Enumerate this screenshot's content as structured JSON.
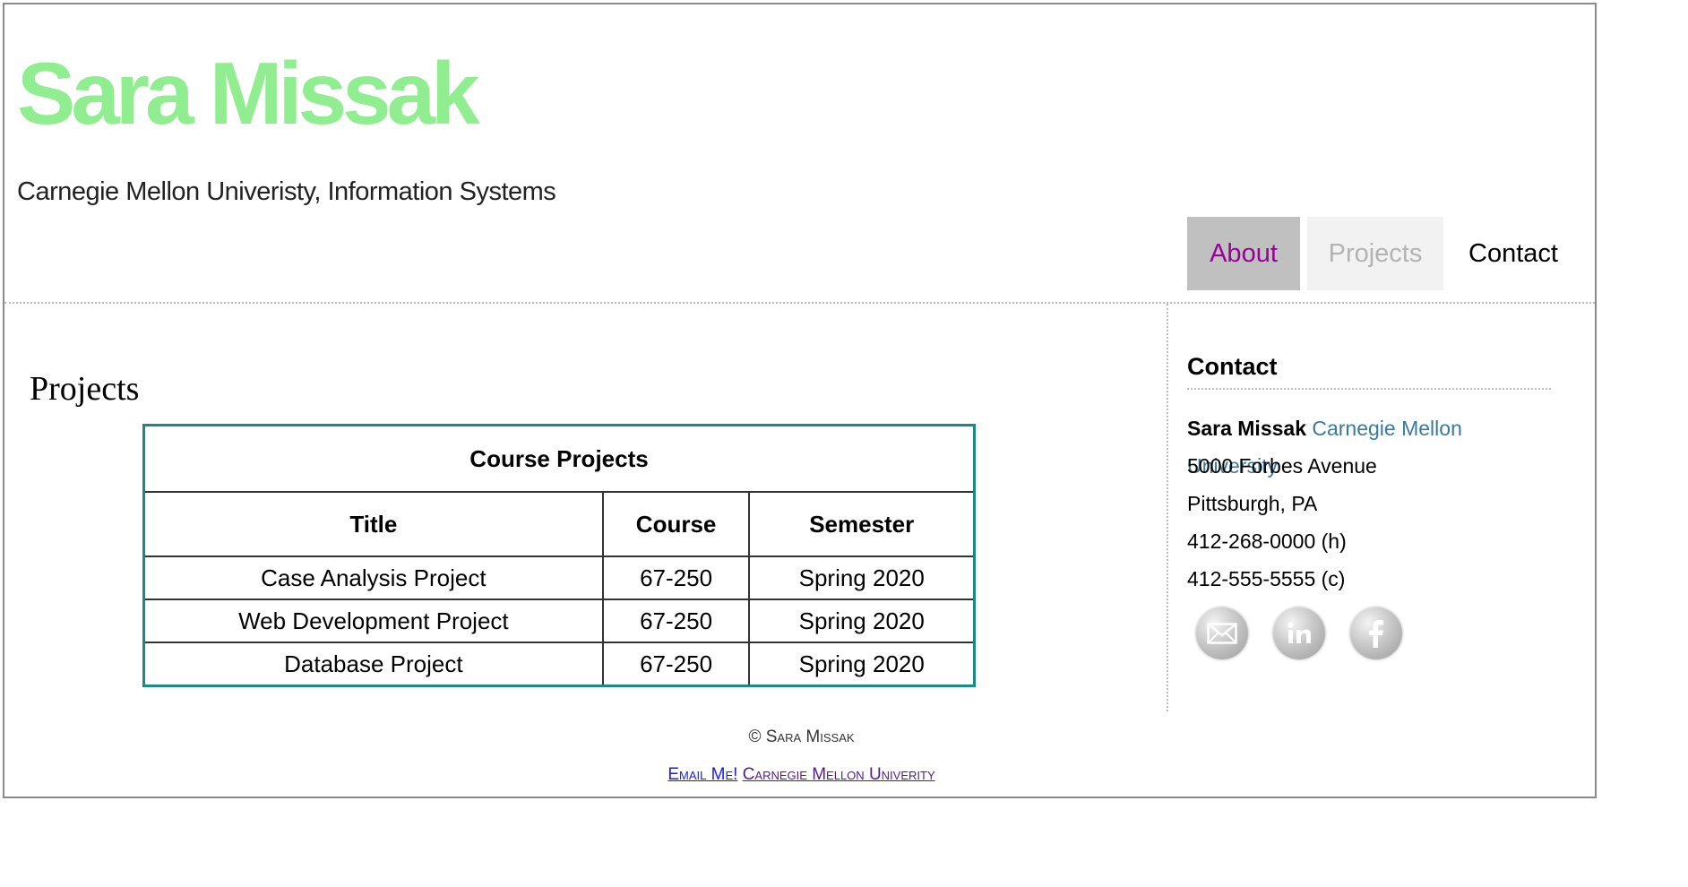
{
  "header": {
    "title": "Sara Missak",
    "subtitle": "Carnegie Mellon Univeristy, Information Systems",
    "title_color": "#90ee90"
  },
  "nav": {
    "items": [
      {
        "label": "About",
        "color": "#990099"
      },
      {
        "label": "Projects",
        "color": "#b3b3b3"
      },
      {
        "label": "Contact",
        "color": "#000000"
      }
    ]
  },
  "main": {
    "heading": "Projects",
    "table": {
      "caption": "Course Projects",
      "columns": [
        "Title",
        "Course",
        "Semester"
      ],
      "rows": [
        [
          "Case Analysis Project",
          "67-250",
          "Spring 2020"
        ],
        [
          "Web Development Project",
          "67-250",
          "Spring 2020"
        ],
        [
          "Database Project",
          "67-250",
          "Spring 2020"
        ]
      ],
      "border_color": "#1a8a84"
    }
  },
  "sidebar": {
    "heading": "Contact",
    "name": "Sara Missak",
    "university": "Carnegie Mellon University",
    "address_line1": "5000 Forbes Avenue",
    "address_line2": "Pittsburgh, PA",
    "phone_home": "412-268-0000 (h)",
    "phone_cell": "412-555-5555 (c)",
    "social_icons": [
      "email-icon",
      "linkedin-icon",
      "facebook-icon"
    ]
  },
  "footer": {
    "copyright": "© Sara Missak",
    "email_link": "Email Me!",
    "university_link": "Carnegie Mellon Univerity"
  }
}
